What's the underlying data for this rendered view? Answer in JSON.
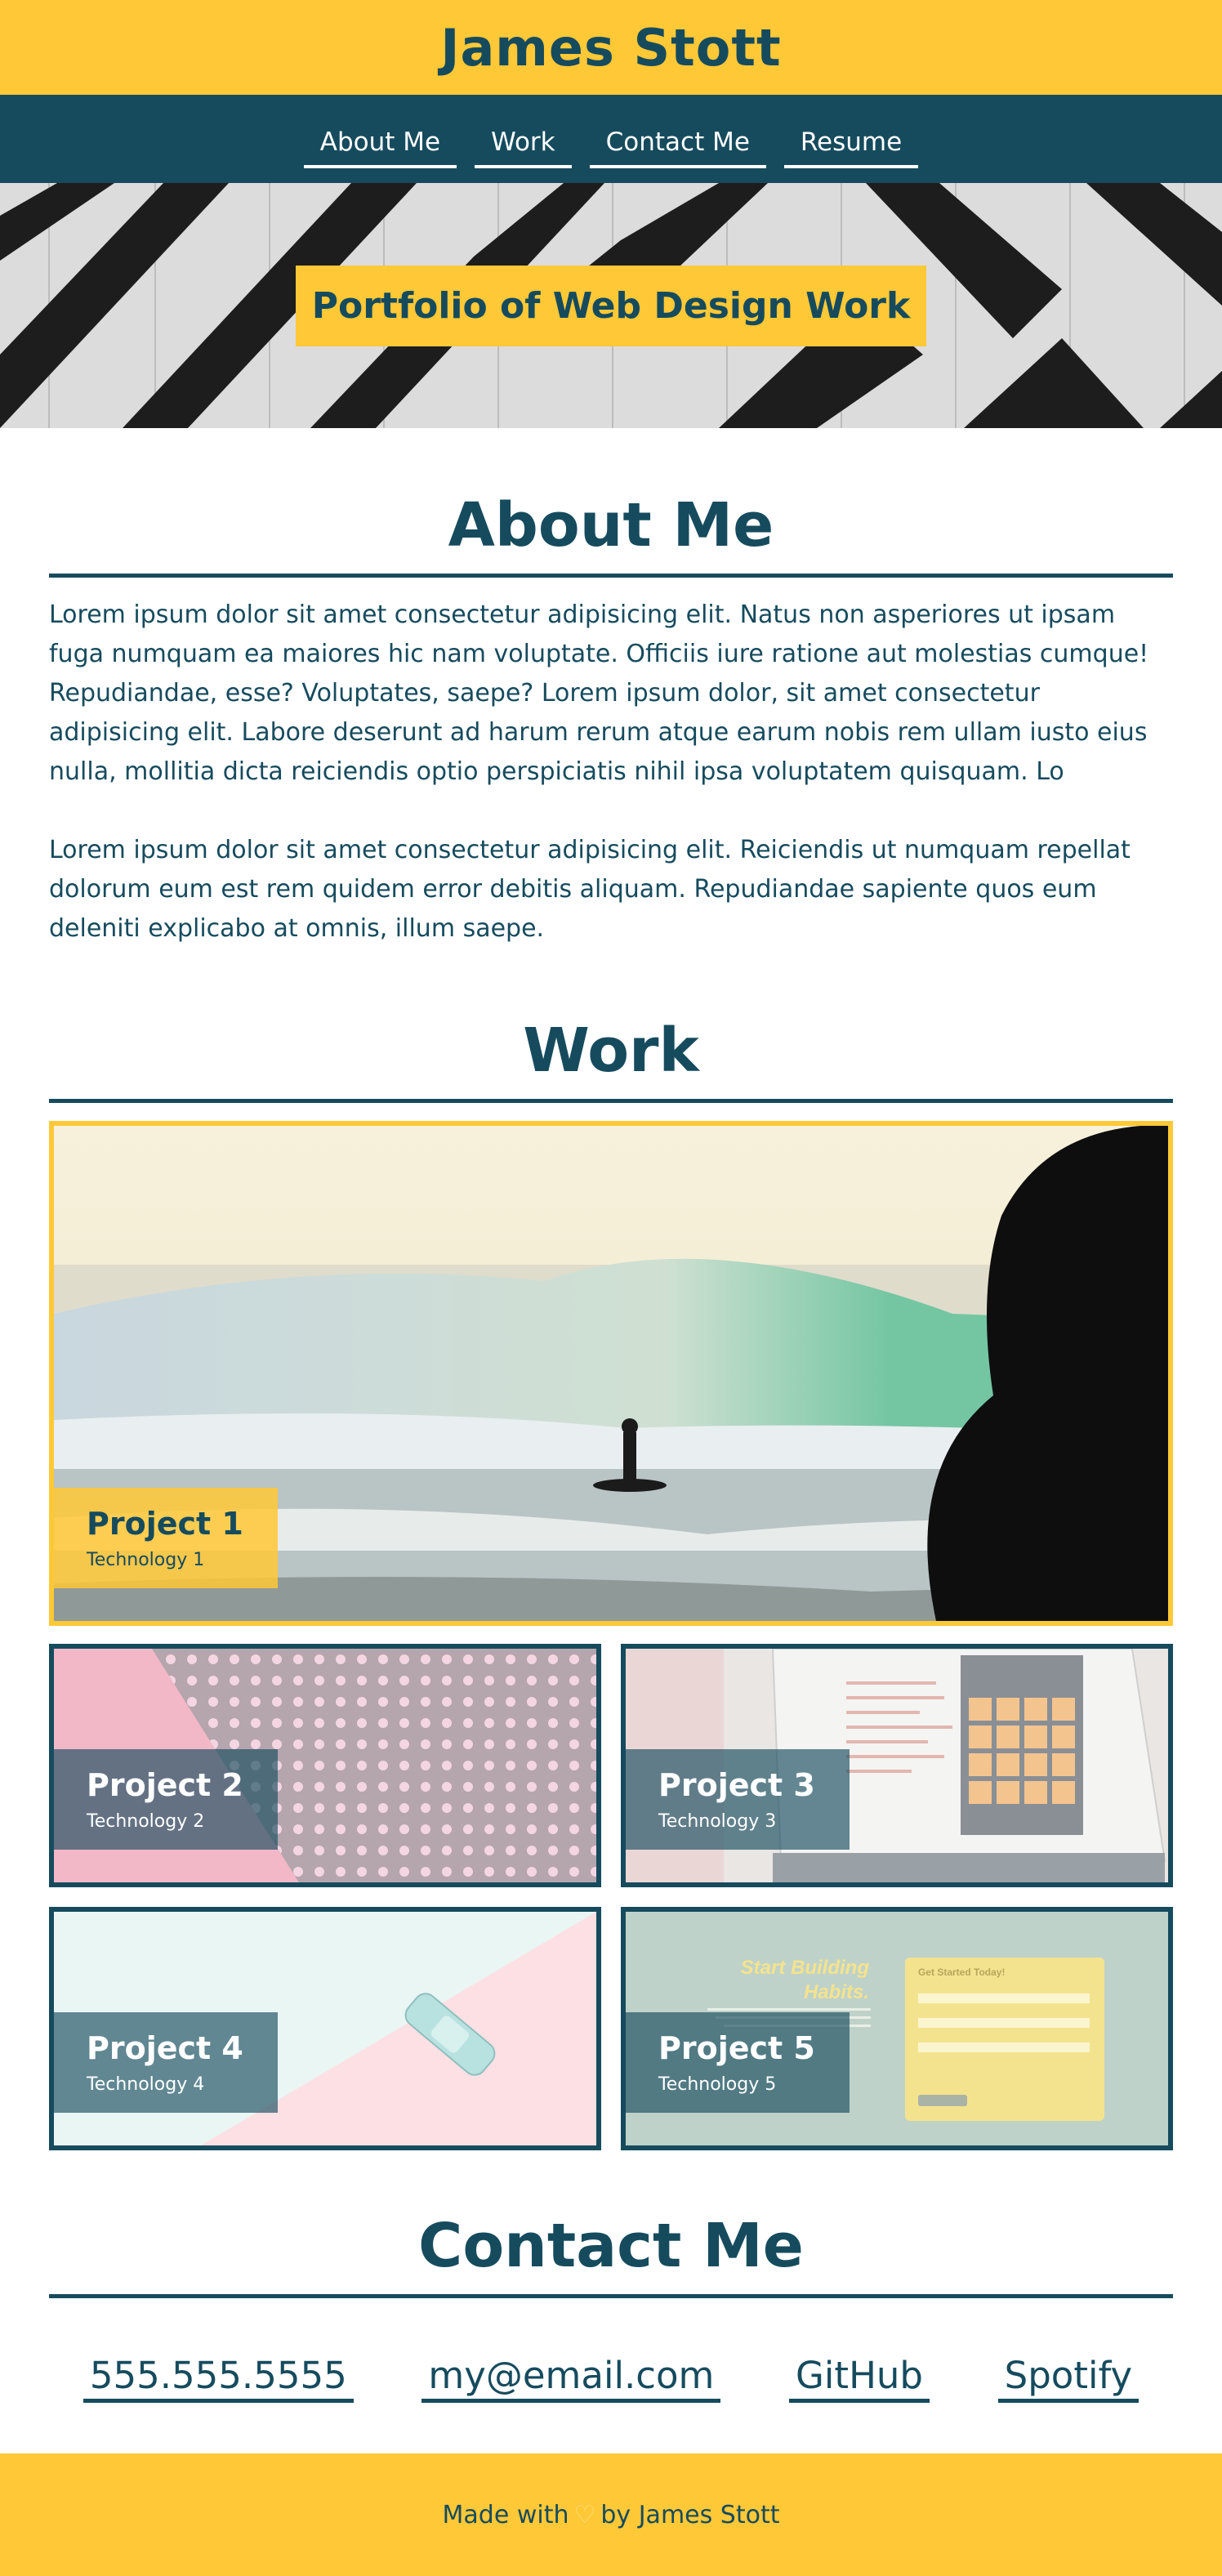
{
  "header": {
    "title": "James Stott"
  },
  "nav": [
    {
      "label": "About Me"
    },
    {
      "label": "Work"
    },
    {
      "label": "Contact Me"
    },
    {
      "label": "Resume"
    }
  ],
  "hero": {
    "banner": "Portfolio of Web Design Work"
  },
  "about": {
    "title": "About Me",
    "paragraphs": [
      "Lorem ipsum dolor sit amet consectetur adipisicing elit. Natus non asperiores ut ipsam fuga numquam ea maiores hic nam voluptate. Officiis iure ratione aut molestias cumque! Repudiandae, esse? Voluptates, saepe? Lorem ipsum dolor, sit amet consectetur adipisicing elit. Labore deserunt ad harum rerum atque earum nobis rem ullam iusto eius nulla, mollitia dicta reiciendis optio perspiciatis nihil ipsa voluptatem quisquam. Lo",
      "Lorem ipsum dolor sit amet consectetur adipisicing elit. Reiciendis ut numquam repellat dolorum eum est rem quidem error debitis aliquam. Repudiandae sapiente quos eum deleniti explicabo at omnis, illum saepe."
    ]
  },
  "work": {
    "title": "Work",
    "projects": [
      {
        "name": "Project 1",
        "tech": "Technology 1"
      },
      {
        "name": "Project 2",
        "tech": "Technology 2"
      },
      {
        "name": "Project 3",
        "tech": "Technology 3"
      },
      {
        "name": "Project 4",
        "tech": "Technology 4"
      },
      {
        "name": "Project 5",
        "tech": "Technology 5"
      }
    ],
    "thumb5": {
      "headline_1": "Start Building",
      "headline_2": "Habits.",
      "form_title": "Get Started Today!"
    }
  },
  "contact": {
    "title": "Contact Me",
    "links": [
      {
        "label": "555.555.5555"
      },
      {
        "label": "my@email.com"
      },
      {
        "label": "GitHub"
      },
      {
        "label": "Spotify"
      }
    ]
  },
  "footer": {
    "prefix": "Made with",
    "heart": "♡",
    "suffix": "by James Stott"
  },
  "colors": {
    "accent": "#ffc836",
    "primary": "#164b5e",
    "background": "#ffffff"
  }
}
